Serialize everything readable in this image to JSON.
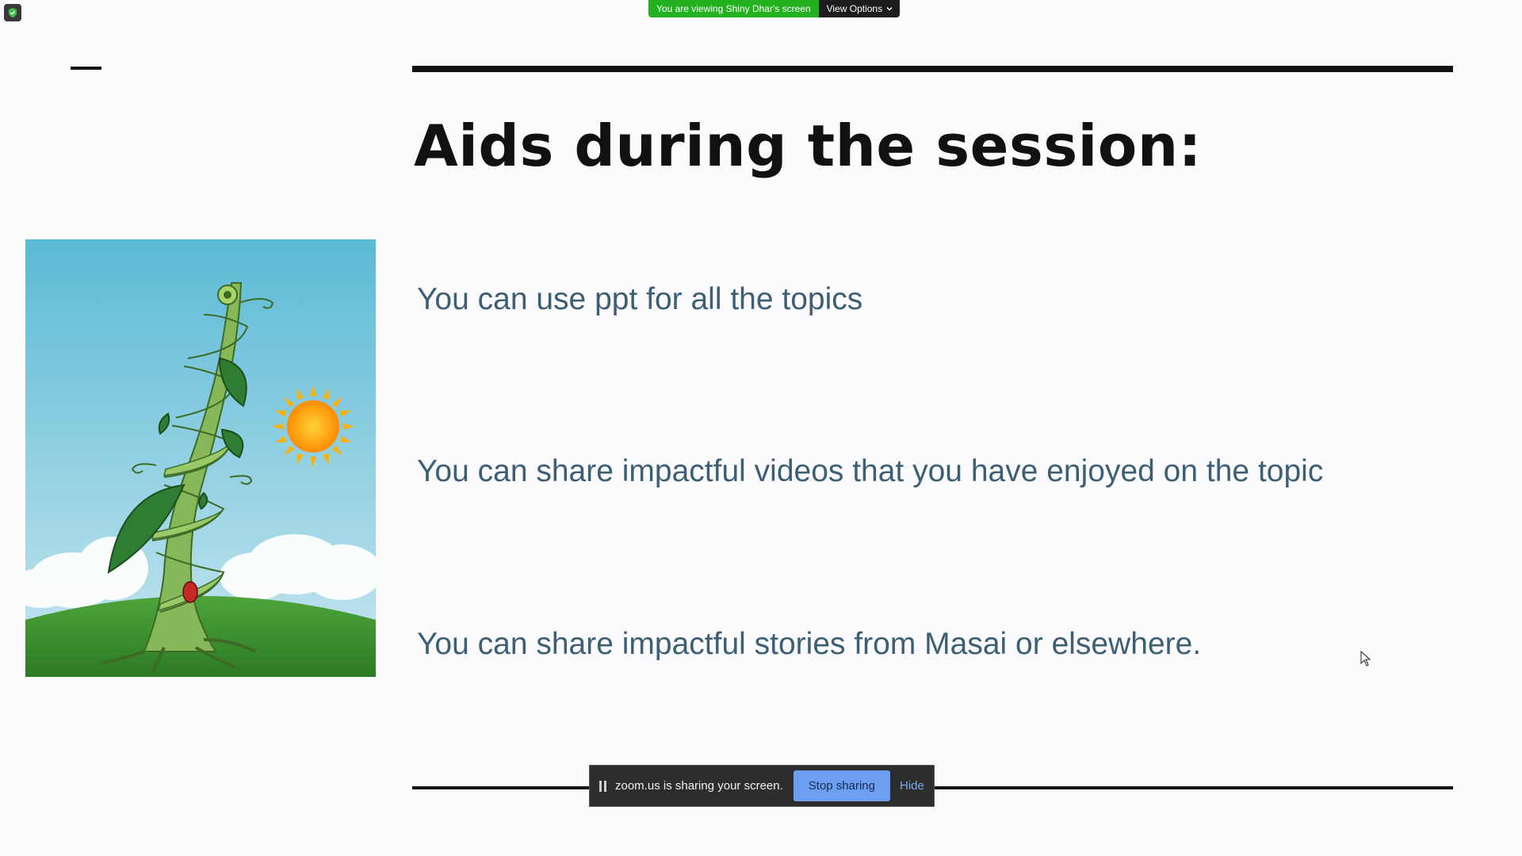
{
  "zoom": {
    "security_icon": "shield-icon",
    "viewing_banner": "You are viewing Shiny Dhar's screen",
    "view_options_label": "View Options",
    "share_bar": {
      "message": "zoom.us is sharing your screen.",
      "stop_label": "Stop sharing",
      "hide_label": "Hide"
    }
  },
  "slide": {
    "title": "Aids during the session:",
    "bullets": [
      "You can use ppt for all the topics",
      "You can share impactful videos that you have enjoyed on the topic",
      "You can share impactful stories from Masai or elsewhere."
    ],
    "image": "beanstalk-with-sun-illustration"
  },
  "colors": {
    "banner_green": "#23b11f",
    "bullet_text": "#3d5f74",
    "stop_button": "#6c9ff2"
  }
}
